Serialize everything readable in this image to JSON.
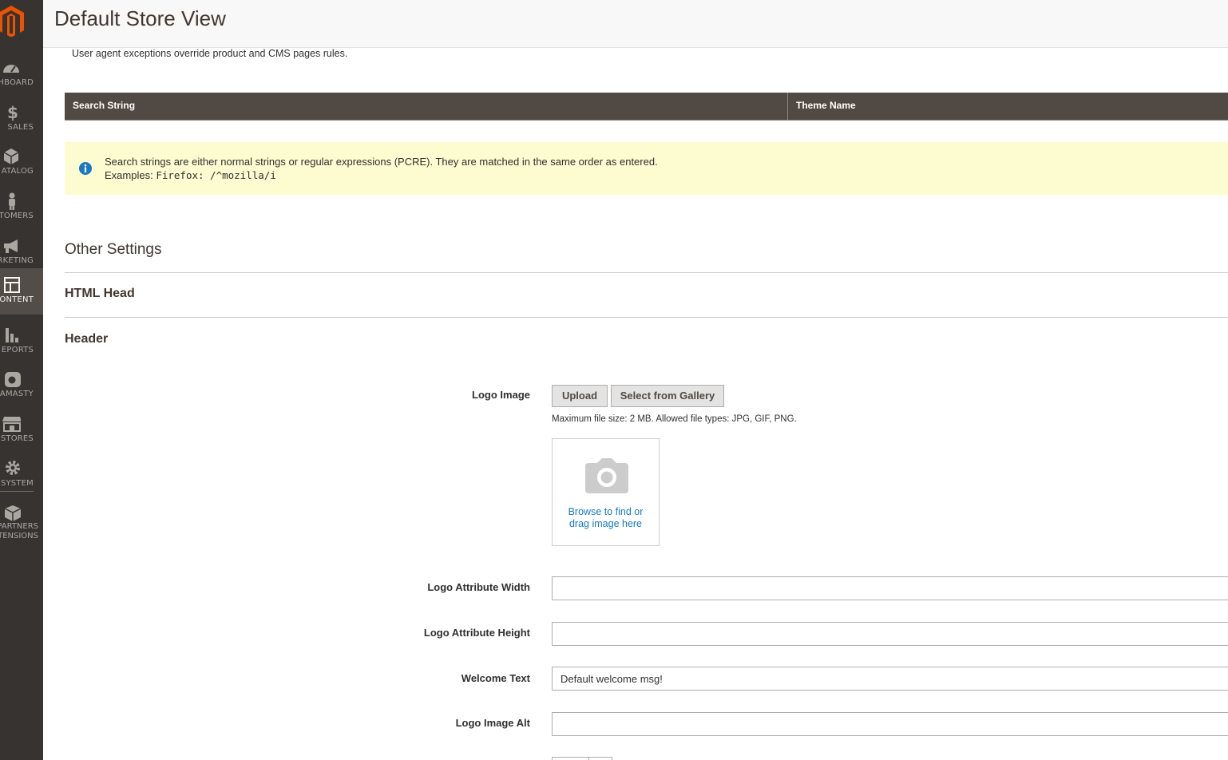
{
  "header": {
    "title": "Default Store View"
  },
  "sidebar": {
    "items": [
      {
        "label": "SHBOARD",
        "icon": "dashboard-icon"
      },
      {
        "label": "SALES",
        "icon": "dollar-icon"
      },
      {
        "label": "ATALOG",
        "icon": "cube-icon"
      },
      {
        "label": "STOMERS",
        "icon": "person-icon"
      },
      {
        "label": "ARKETING",
        "icon": "megaphone-icon"
      },
      {
        "label": "CONTENT",
        "icon": "layout-icon"
      },
      {
        "label": "EPORTS",
        "icon": "bar-chart-icon"
      },
      {
        "label": "AMASTY",
        "icon": "amasty-icon"
      },
      {
        "label": "STORES",
        "icon": "storefront-icon"
      },
      {
        "label": "SYSTEM",
        "icon": "gear-icon"
      },
      {
        "label": "PARTNERS",
        "label2": "TENSIONS",
        "icon": "box-icon"
      }
    ]
  },
  "main": {
    "note": "User agent exceptions override product and CMS pages rules.",
    "table": {
      "columns": [
        "Search String",
        "Theme Name"
      ]
    },
    "message": {
      "line1": "Search strings are either normal strings or regular expressions (PCRE). They are matched in the same order as entered.",
      "line2_prefix": "Examples:",
      "line2_code": "Firefox: /^mozilla/i"
    },
    "other_settings": "Other Settings",
    "html_head": "HTML Head",
    "header_section": "Header",
    "logo_image": {
      "label": "Logo Image",
      "upload": "Upload",
      "gallery": "Select from Gallery",
      "note": "Maximum file size: 2 MB. Allowed file types: JPG, GIF, PNG.",
      "dropzone_line1": "Browse to find or",
      "dropzone_line2": "drag image here"
    },
    "fields": {
      "logo_width": {
        "label": "Logo Attribute Width",
        "value": ""
      },
      "logo_height": {
        "label": "Logo Attribute Height",
        "value": ""
      },
      "welcome": {
        "label": "Welcome Text",
        "value": "Default welcome msg!"
      },
      "logo_alt": {
        "label": "Logo Image Alt",
        "value": ""
      }
    }
  }
}
